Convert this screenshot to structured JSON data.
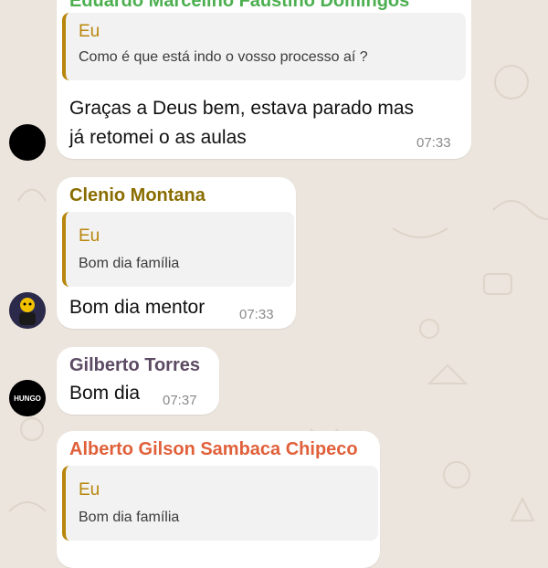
{
  "colors": {
    "background": "#ece5dd",
    "bubble": "#ffffff",
    "quote_accent": "#b8860b",
    "sender_eduardo": "#4caf50",
    "sender_clenio": "#8a6d00",
    "sender_gilberto": "#5c4a63",
    "sender_alberto": "#e0603a"
  },
  "messages": [
    {
      "sender": "Eduardo Marcelino Faustino Domingos",
      "quote": {
        "author": "Eu",
        "text": "Como é que está indo o vosso processo aí ?"
      },
      "text_line1": "Graças a Deus bem, estava parado mas",
      "text_line2": "já retomei o as aulas",
      "time": "07:33",
      "avatar": "black-circle-avatar"
    },
    {
      "sender": "Clenio Montana",
      "quote": {
        "author": "Eu",
        "text": "Bom dia família"
      },
      "text": "Bom dia mentor",
      "time": "07:33",
      "avatar": "cartoon-character-avatar"
    },
    {
      "sender": "Gilberto Torres",
      "text": "Bom dia",
      "time": "07:37",
      "avatar": "logo-avatar",
      "avatar_logo_text": "HUNGO"
    },
    {
      "sender": "Alberto Gilson Sambaca Chipeco",
      "quote": {
        "author": "Eu",
        "text": "Bom dia família"
      }
    }
  ]
}
